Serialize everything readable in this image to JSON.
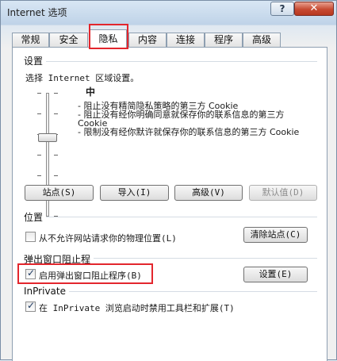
{
  "window": {
    "title": "Internet 选项",
    "help_label": "?",
    "close_label": "✕"
  },
  "tabs": [
    {
      "label": "常规"
    },
    {
      "label": "安全"
    },
    {
      "label": "隐私"
    },
    {
      "label": "内容"
    },
    {
      "label": "连接"
    },
    {
      "label": "程序"
    },
    {
      "label": "高级"
    }
  ],
  "active_tab": "隐私",
  "settings": {
    "group_label": "设置",
    "zone_text": "选择 Internet 区域设置。",
    "level_title": "中",
    "level_lines": [
      "- 阻止没有精简隐私策略的第三方 Cookie",
      "- 阻止没有经你明确同意就保存你的联系信息的第三方 Cookie",
      "- 限制没有经你默许就保存你的联系信息的第三方 Cookie"
    ],
    "buttons": {
      "sites": "站点(S)",
      "import": "导入(I)",
      "advanced": "高级(V)",
      "default": "默认值(D)"
    }
  },
  "location": {
    "group_label": "位置",
    "checkbox_label": "从不允许网站请求你的物理位置(L)",
    "checked": false,
    "clear_button": "清除站点(C)"
  },
  "popup_blocker": {
    "group_label": "弹出窗口阻止程",
    "checkbox_label": "启用弹出窗口阻止程序(B)",
    "checked": true,
    "settings_button": "设置(E)"
  },
  "inprivate": {
    "group_label": "InPrivate",
    "checkbox_label": "在 InPrivate 浏览启动时禁用工具栏和扩展(T)",
    "checked": true
  },
  "colors": {
    "highlight": "#e3262d"
  }
}
